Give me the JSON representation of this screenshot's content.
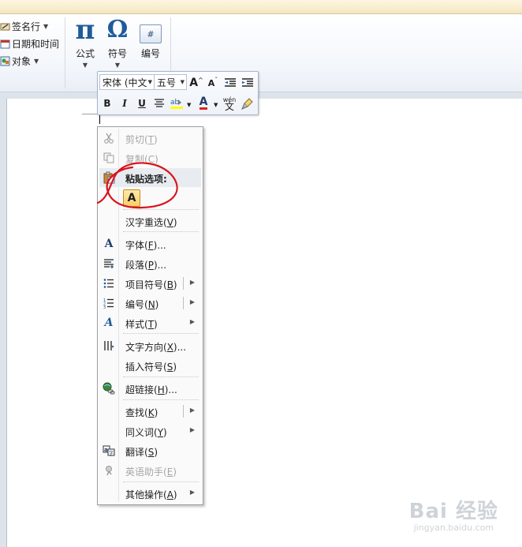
{
  "ribbon": {
    "insert_items": [
      {
        "label": "签名行",
        "has_dropdown": true,
        "icon": "signature-line-icon"
      },
      {
        "label": "日期和时间",
        "has_dropdown": false,
        "icon": "date-time-icon"
      },
      {
        "label": "对象",
        "has_dropdown": true,
        "icon": "object-icon"
      }
    ],
    "equation_label": "公式",
    "equation_symbol": "π",
    "symbol_label": "符号",
    "symbol_glyph": "Ω",
    "number_label": "编号",
    "number_glyph": "#"
  },
  "mini_toolbar": {
    "font_name": "宋体 (中文",
    "font_size": "五号",
    "bold": "B",
    "italic": "I",
    "underline": "U",
    "font_color_letter": "A",
    "grow_font": "A",
    "shrink_font": "A",
    "phonetic_top": "wén",
    "phonetic_bottom": "文",
    "highlight_color": "#ffff00",
    "font_color": "#e02020"
  },
  "context_menu": {
    "cut": {
      "label": "剪切(",
      "key": "T",
      "end": ")",
      "enabled": false
    },
    "copy": {
      "label": "复制(",
      "key": "C",
      "end": ")",
      "enabled": false
    },
    "paste_options": {
      "label": "粘贴选项:",
      "option": "A"
    },
    "reconvert": {
      "label": "汉字重选(",
      "key": "V",
      "end": ")"
    },
    "font": {
      "label": "字体(",
      "key": "F",
      "end": ")..."
    },
    "paragraph": {
      "label": "段落(",
      "key": "P",
      "end": ")..."
    },
    "bullets": {
      "label": "项目符号(",
      "key": "B",
      "end": ")"
    },
    "numbering": {
      "label": "编号(",
      "key": "N",
      "end": ")"
    },
    "styles": {
      "label": "样式(",
      "key": "T",
      "end": ")"
    },
    "text_direction": {
      "label": "文字方向(",
      "key": "X",
      "end": ")..."
    },
    "insert_symbol": {
      "label": "插入符号(",
      "key": "S",
      "end": ")"
    },
    "hyperlink": {
      "label": "超链接(",
      "key": "H",
      "end": ")..."
    },
    "lookup": {
      "label": "查找(",
      "key": "K",
      "end": ")"
    },
    "synonyms": {
      "label": "同义词(",
      "key": "Y",
      "end": ")"
    },
    "translate": {
      "label": "翻译(",
      "key": "S",
      "end": ")"
    },
    "english_assistant": {
      "label": "英语助手(",
      "key": "E",
      "end": ")",
      "enabled": false
    },
    "more_actions": {
      "label": "其他操作(",
      "key": "A",
      "end": ")"
    }
  },
  "watermark": {
    "brand": "Bai 经验",
    "url": "jingyan.baidu.com"
  },
  "annotation_color": "#d9131b"
}
